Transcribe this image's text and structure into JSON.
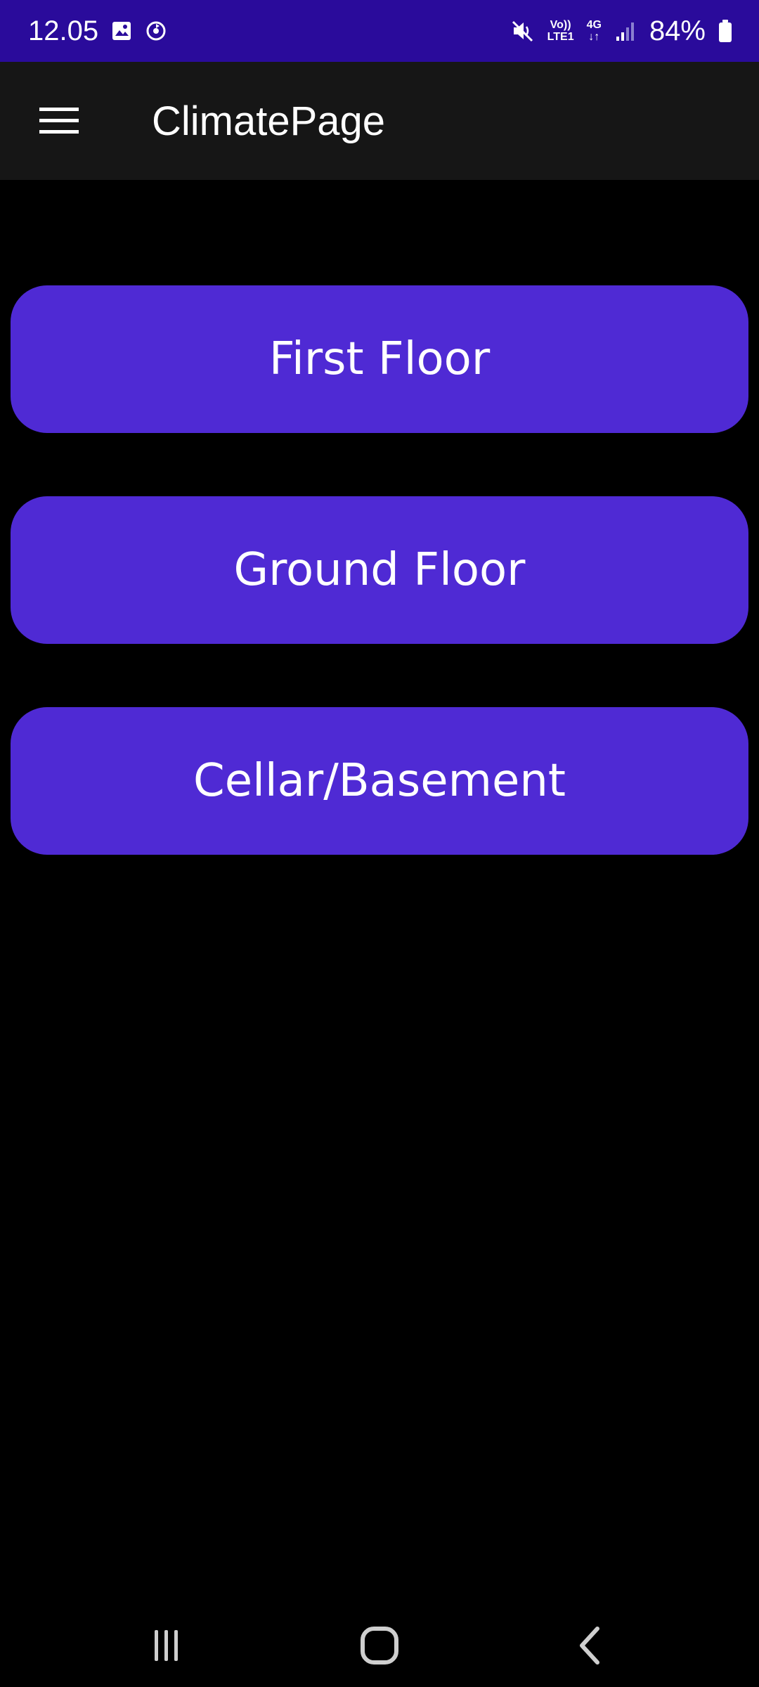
{
  "status_bar": {
    "time": "12.05",
    "network_top": "Vo))",
    "network_bottom": "LTE1",
    "network_type": "4G",
    "battery": "84%",
    "background_color": "#2a0b9b",
    "icons": [
      "gallery-icon",
      "sync-icon",
      "mute-icon",
      "signal-icon",
      "battery-icon"
    ]
  },
  "app_bar": {
    "title": "ClimatePage",
    "menu_icon": "hamburger-menu-icon",
    "background_color": "#161616"
  },
  "floors": [
    {
      "label": "First Floor"
    },
    {
      "label": "Ground Floor"
    },
    {
      "label": "Cellar/Basement"
    }
  ],
  "button_color": "#4f2ad4",
  "nav_bar": {
    "icons": [
      "recent-apps-icon",
      "home-icon",
      "back-icon"
    ]
  }
}
